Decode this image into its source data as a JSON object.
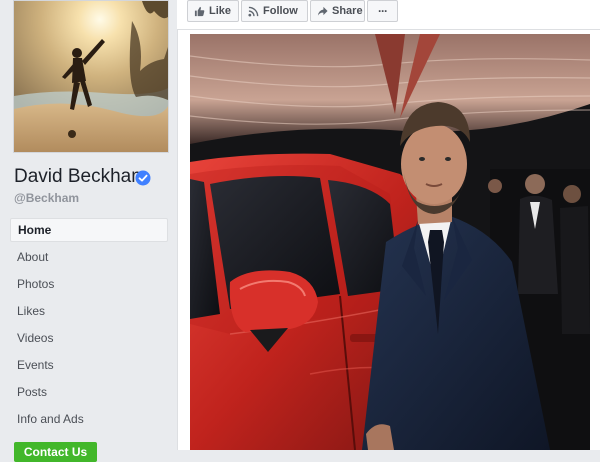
{
  "profile": {
    "name": "David Beckham",
    "handle": "@Beckham",
    "verified": true,
    "photo_icon": "profile-photo-beach"
  },
  "nav": {
    "items": [
      {
        "label": "Home",
        "active": true
      },
      {
        "label": "About"
      },
      {
        "label": "Photos"
      },
      {
        "label": "Likes"
      },
      {
        "label": "Videos"
      },
      {
        "label": "Events"
      },
      {
        "label": "Posts"
      },
      {
        "label": "Info and Ads"
      }
    ],
    "cta_label": "Contact Us"
  },
  "actions": {
    "like_label": "Like",
    "follow_label": "Follow",
    "share_label": "Share",
    "more_label": "···"
  },
  "colors": {
    "background": "#e9ebee",
    "verified": "#4080ff",
    "cta": "#42b72a"
  }
}
